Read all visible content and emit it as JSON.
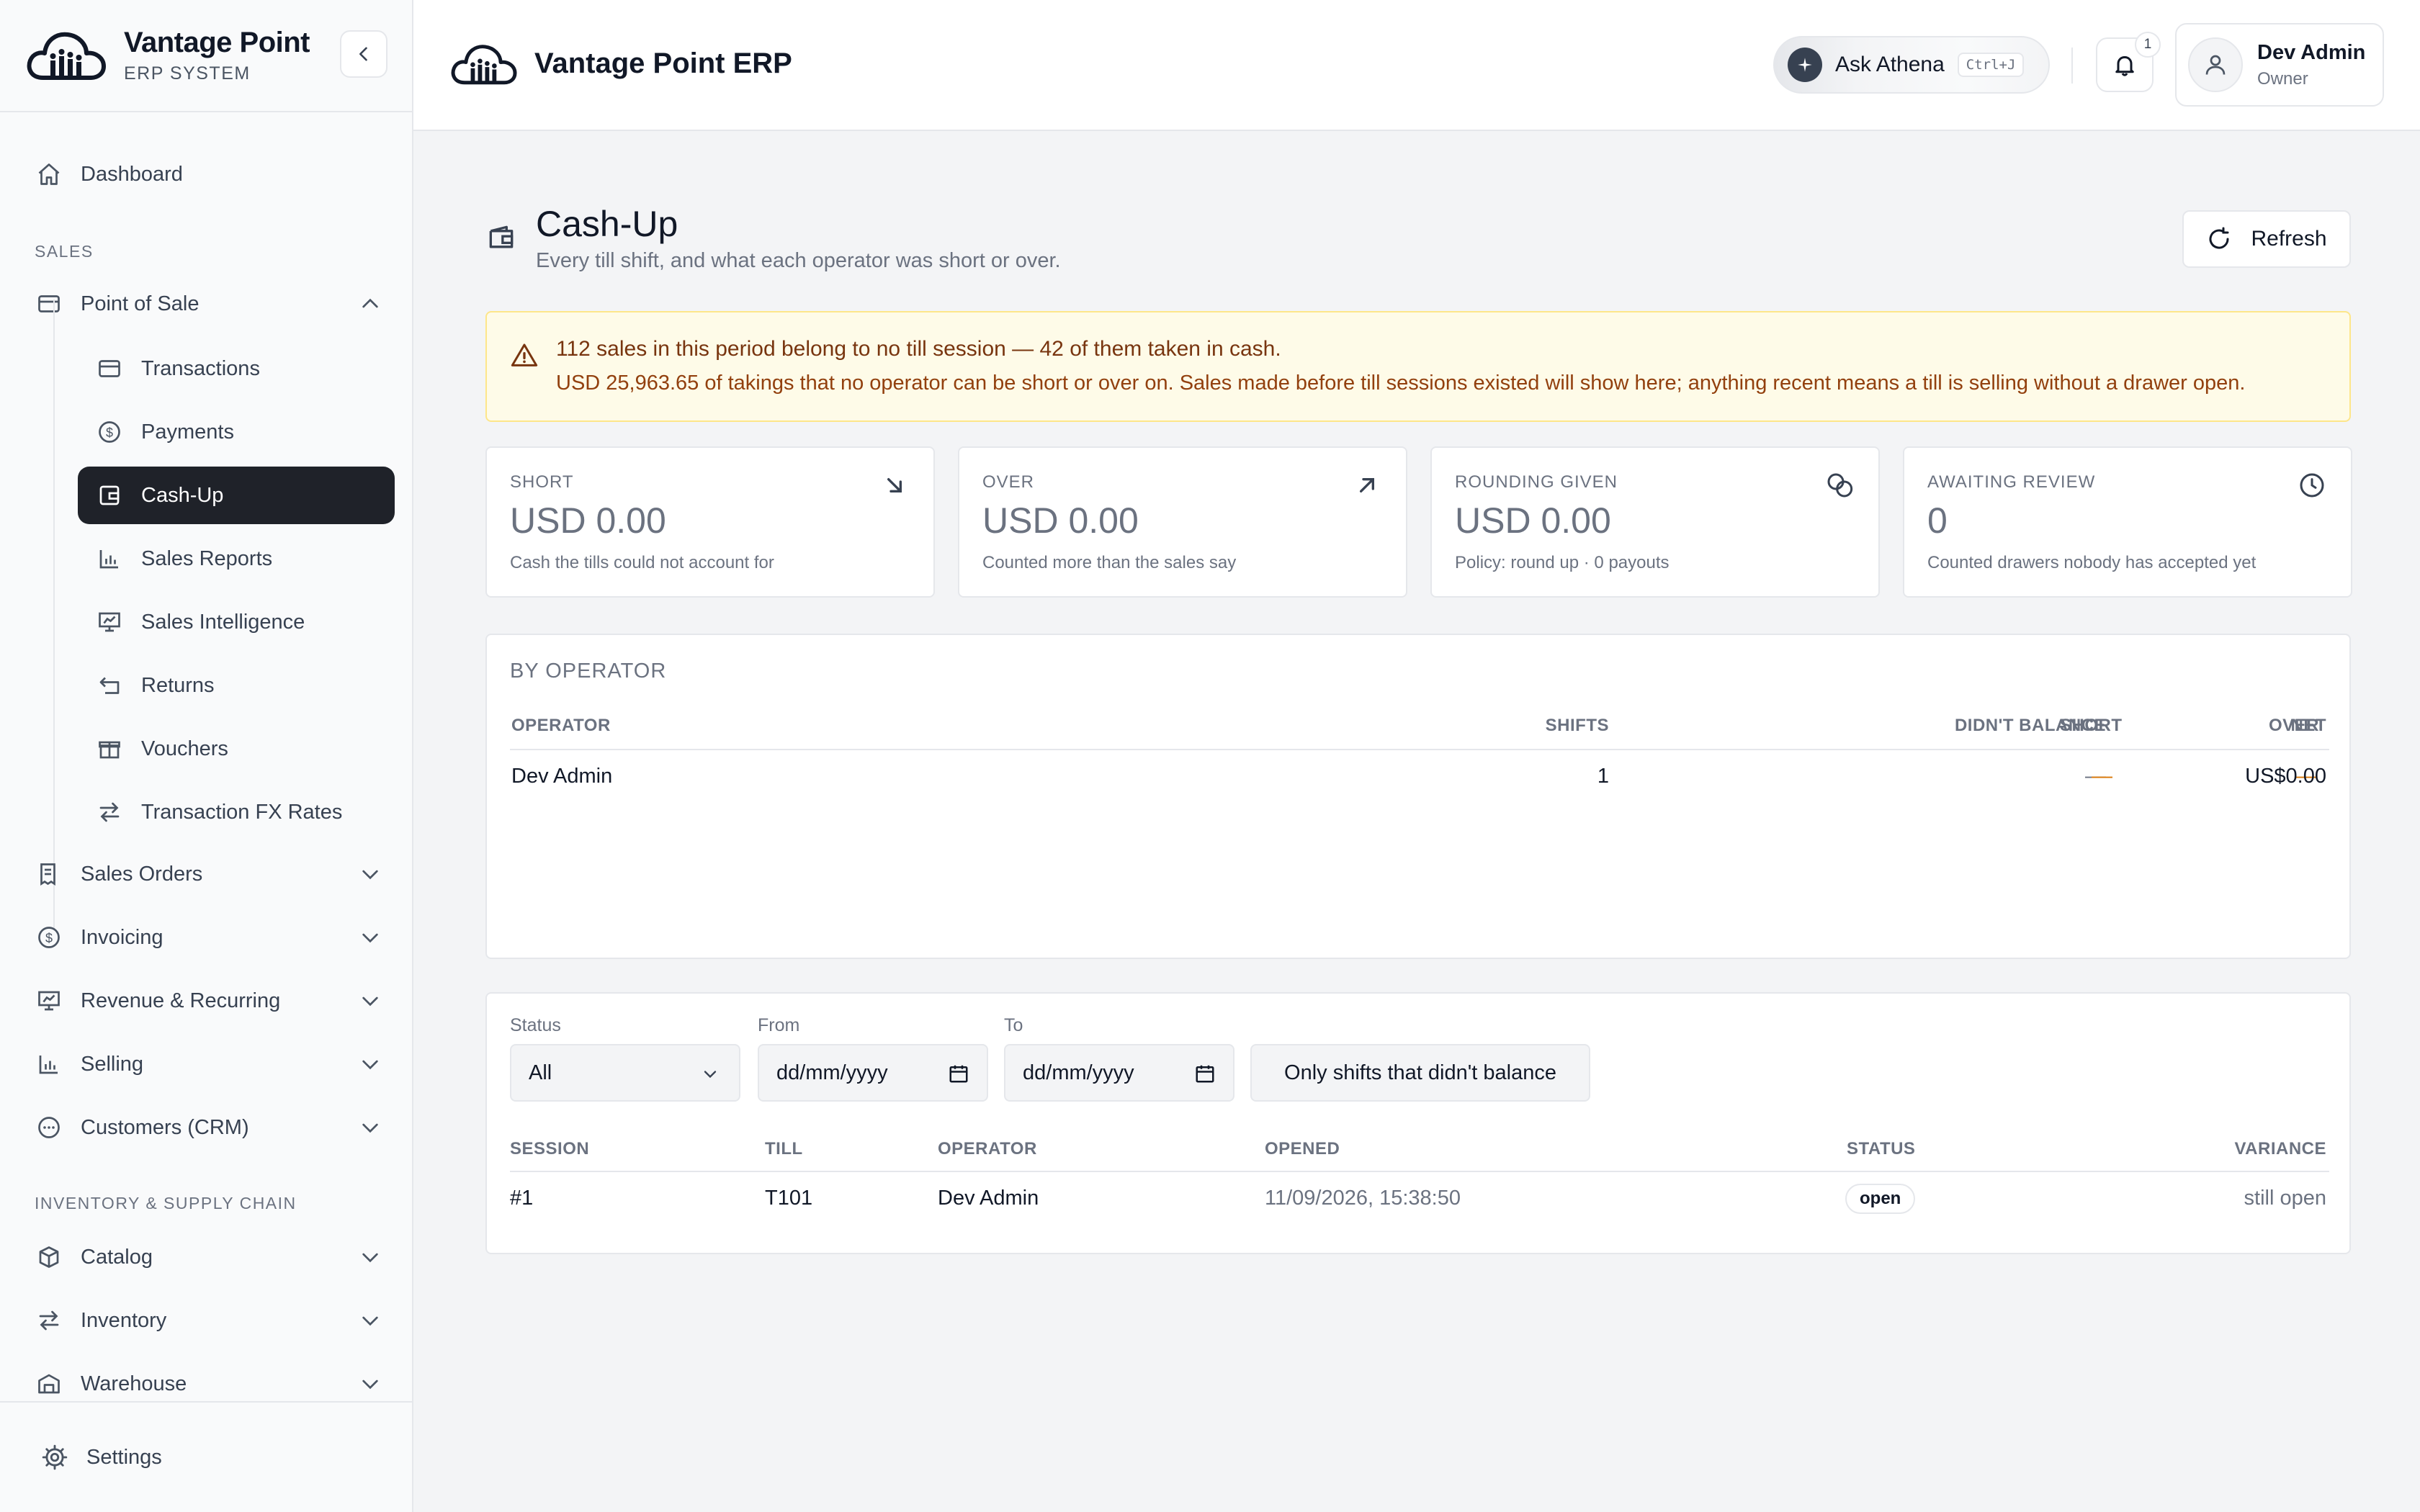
{
  "brand": {
    "title": "Vantage Point",
    "subtitle": "ERP SYSTEM"
  },
  "header": {
    "title": "Vantage Point ERP",
    "ask_label": "Ask Athena",
    "ask_shortcut": "Ctrl+J",
    "notif_count": "1",
    "user_name": "Dev Admin",
    "user_role": "Owner"
  },
  "nav": {
    "dashboard": "Dashboard",
    "section_sales": "SALES",
    "point_of_sale": "Point of Sale",
    "pos_items": [
      "Transactions",
      "Payments",
      "Cash-Up",
      "Sales Reports",
      "Sales Intelligence",
      "Returns",
      "Vouchers",
      "Transaction FX Rates"
    ],
    "sales_orders": "Sales Orders",
    "invoicing": "Invoicing",
    "revenue": "Revenue & Recurring",
    "selling": "Selling",
    "crm": "Customers (CRM)",
    "section_inventory": "INVENTORY & SUPPLY CHAIN",
    "catalog": "Catalog",
    "inventory": "Inventory",
    "warehouse": "Warehouse",
    "settings": "Settings"
  },
  "page": {
    "title": "Cash-Up",
    "subtitle": "Every till shift, and what each operator was short or over.",
    "refresh_label": "Refresh"
  },
  "alert": {
    "line1": "112 sales in this period belong to no till session — 42 of them taken in cash.",
    "line2": "USD 25,963.65 of takings that no operator can be short or over on. Sales made before till sessions existed will show here; anything recent means a till is selling without a drawer open."
  },
  "stats": [
    {
      "label": "SHORT",
      "value": "USD 0.00",
      "desc": "Cash the tills could not account for",
      "icon": "arrow-down-right-icon"
    },
    {
      "label": "OVER",
      "value": "USD 0.00",
      "desc": "Counted more than the sales say",
      "icon": "arrow-up-right-icon"
    },
    {
      "label": "ROUNDING GIVEN",
      "value": "USD 0.00",
      "desc": "Policy: round up · 0 payouts",
      "icon": "coins-icon"
    },
    {
      "label": "AWAITING REVIEW",
      "value": "0",
      "desc": "Counted drawers nobody has accepted yet",
      "icon": "clock-icon"
    }
  ],
  "by_operator": {
    "title": "BY OPERATOR",
    "columns": [
      "OPERATOR",
      "SHIFTS",
      "DIDN'T BALANCE",
      "SHORT",
      "OVER",
      "NET"
    ],
    "rows": [
      {
        "operator": "Dev Admin",
        "shifts": "1",
        "didnt_balance": "—",
        "short": "—",
        "over": "—",
        "net": "US$0.00"
      }
    ]
  },
  "filters": {
    "status_label": "Status",
    "status_value": "All",
    "from_label": "From",
    "from_placeholder": "dd/mm/yyyy",
    "to_label": "To",
    "to_placeholder": "dd/mm/yyyy",
    "toggle_label": "Only shifts that didn't balance"
  },
  "sessions": {
    "columns": [
      "SESSION",
      "TILL",
      "OPERATOR",
      "OPENED",
      "STATUS",
      "VARIANCE"
    ],
    "rows": [
      {
        "session": "#1",
        "till": "T101",
        "operator": "Dev Admin",
        "opened": "11/09/2026, 15:38:50",
        "status": "open",
        "variance": "still open"
      }
    ]
  },
  "colors": {
    "accent": "#1f2229",
    "warning_bg": "#fefbe8",
    "warning_border": "#fde68a",
    "dash_amber": "#d97706"
  }
}
